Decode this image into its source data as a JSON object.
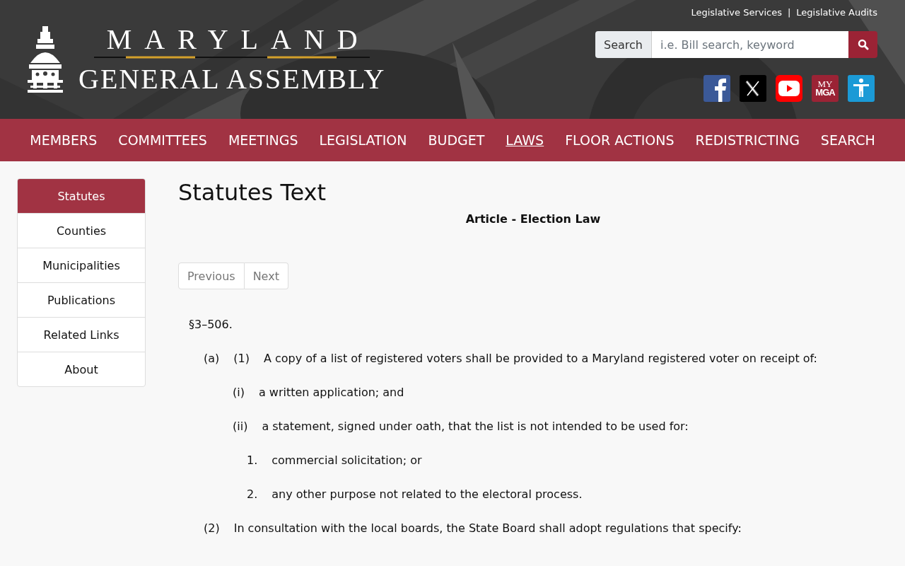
{
  "header": {
    "logo": {
      "line1": "MARYLAND",
      "line2": "GENERAL ASSEMBLY"
    },
    "top_links": [
      "Legislative Services",
      "Legislative Audits"
    ],
    "top_links_separator": "|",
    "search": {
      "label": "Search",
      "placeholder": "i.e. Bill search, keyword"
    },
    "social": [
      {
        "kind": "facebook"
      },
      {
        "kind": "x"
      },
      {
        "kind": "youtube"
      },
      {
        "kind": "mymga",
        "texts": [
          "MY",
          "MGA"
        ]
      },
      {
        "kind": "accessibility"
      }
    ]
  },
  "nav": [
    {
      "label": "MEMBERS",
      "selected": false
    },
    {
      "label": "COMMITTEES",
      "selected": false
    },
    {
      "label": "MEETINGS",
      "selected": false
    },
    {
      "label": "LEGISLATION",
      "selected": false
    },
    {
      "label": "BUDGET",
      "selected": false
    },
    {
      "label": "LAWS",
      "selected": true
    },
    {
      "label": "FLOOR ACTIONS",
      "selected": false
    },
    {
      "label": "REDISTRICTING",
      "selected": false
    },
    {
      "label": "SEARCH",
      "selected": false
    }
  ],
  "sidebar": {
    "items": [
      {
        "label": "Statutes",
        "selected": true
      },
      {
        "label": "Counties",
        "selected": false
      },
      {
        "label": "Municipalities",
        "selected": false
      },
      {
        "label": "Publications",
        "selected": false
      },
      {
        "label": "Related Links",
        "selected": false
      },
      {
        "label": "About",
        "selected": false
      }
    ]
  },
  "content": {
    "title": "Statutes Text",
    "article": "Article - Election Law",
    "pager": [
      "Previous",
      "Next"
    ],
    "statute": [
      {
        "labels": [
          "§3–506."
        ],
        "children": [
          {
            "labels": [
              "(a)",
              "(1)"
            ],
            "text": "A copy of a list of registered voters shall be provided to a Maryland registered voter on receipt of:",
            "children": [
              {
                "labels": [
                  "(i)"
                ],
                "text": "a written application; and"
              },
              {
                "labels": [
                  "(ii)"
                ],
                "text": "a statement, signed under oath, that the list is not intended to be used for:",
                "children": [
                  {
                    "labels": [
                      "1."
                    ],
                    "text": "commercial solicitation; or"
                  },
                  {
                    "labels": [
                      "2."
                    ],
                    "text": "any other purpose not related to the electoral process."
                  }
                ]
              }
            ]
          },
          {
            "labels": [
              "(2)"
            ],
            "text": "In consultation with the local boards, the State Board shall adopt regulations that specify:"
          }
        ]
      }
    ]
  }
}
